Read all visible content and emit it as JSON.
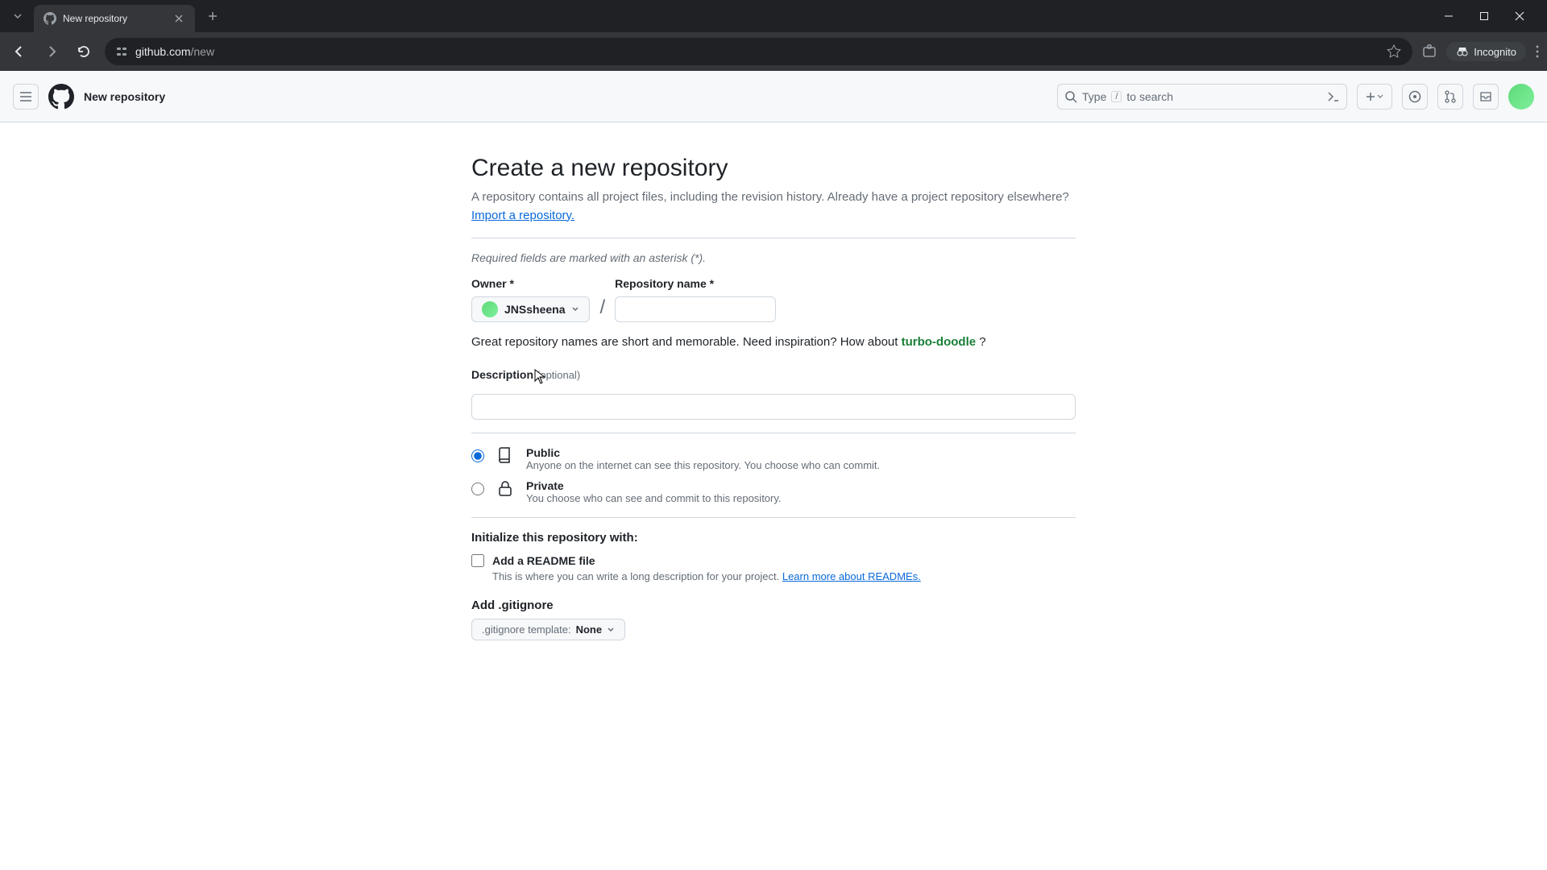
{
  "browser": {
    "tab_title": "New repository",
    "url_domain": "github.com",
    "url_path": "/new",
    "incognito_label": "Incognito"
  },
  "gh_header": {
    "page_title": "New repository",
    "search_placeholder_prefix": "Type",
    "search_key": "/",
    "search_placeholder_suffix": "to search"
  },
  "form": {
    "heading": "Create a new repository",
    "subtitle_text": "A repository contains all project files, including the revision history. Already have a project repository elsewhere?",
    "import_link": "Import a repository.",
    "required_note": "Required fields are marked with an asterisk (*).",
    "owner_label": "Owner *",
    "owner_value": "JNSsheena",
    "repo_name_label": "Repository name *",
    "repo_name_value": "",
    "hint_text": "Great repository names are short and memorable. Need inspiration? How about ",
    "suggestion": "turbo-doodle",
    "hint_suffix": " ?",
    "desc_label": "Description",
    "desc_optional": "(optional)",
    "desc_value": "",
    "visibility": {
      "public_title": "Public",
      "public_desc": "Anyone on the internet can see this repository. You choose who can commit.",
      "private_title": "Private",
      "private_desc": "You choose who can see and commit to this repository."
    },
    "init_heading": "Initialize this repository with:",
    "readme_label": "Add a README file",
    "readme_desc": "This is where you can write a long description for your project. ",
    "readme_link": "Learn more about READMEs.",
    "gitignore_heading": "Add .gitignore",
    "gitignore_prefix": ".gitignore template: ",
    "gitignore_value": "None"
  }
}
